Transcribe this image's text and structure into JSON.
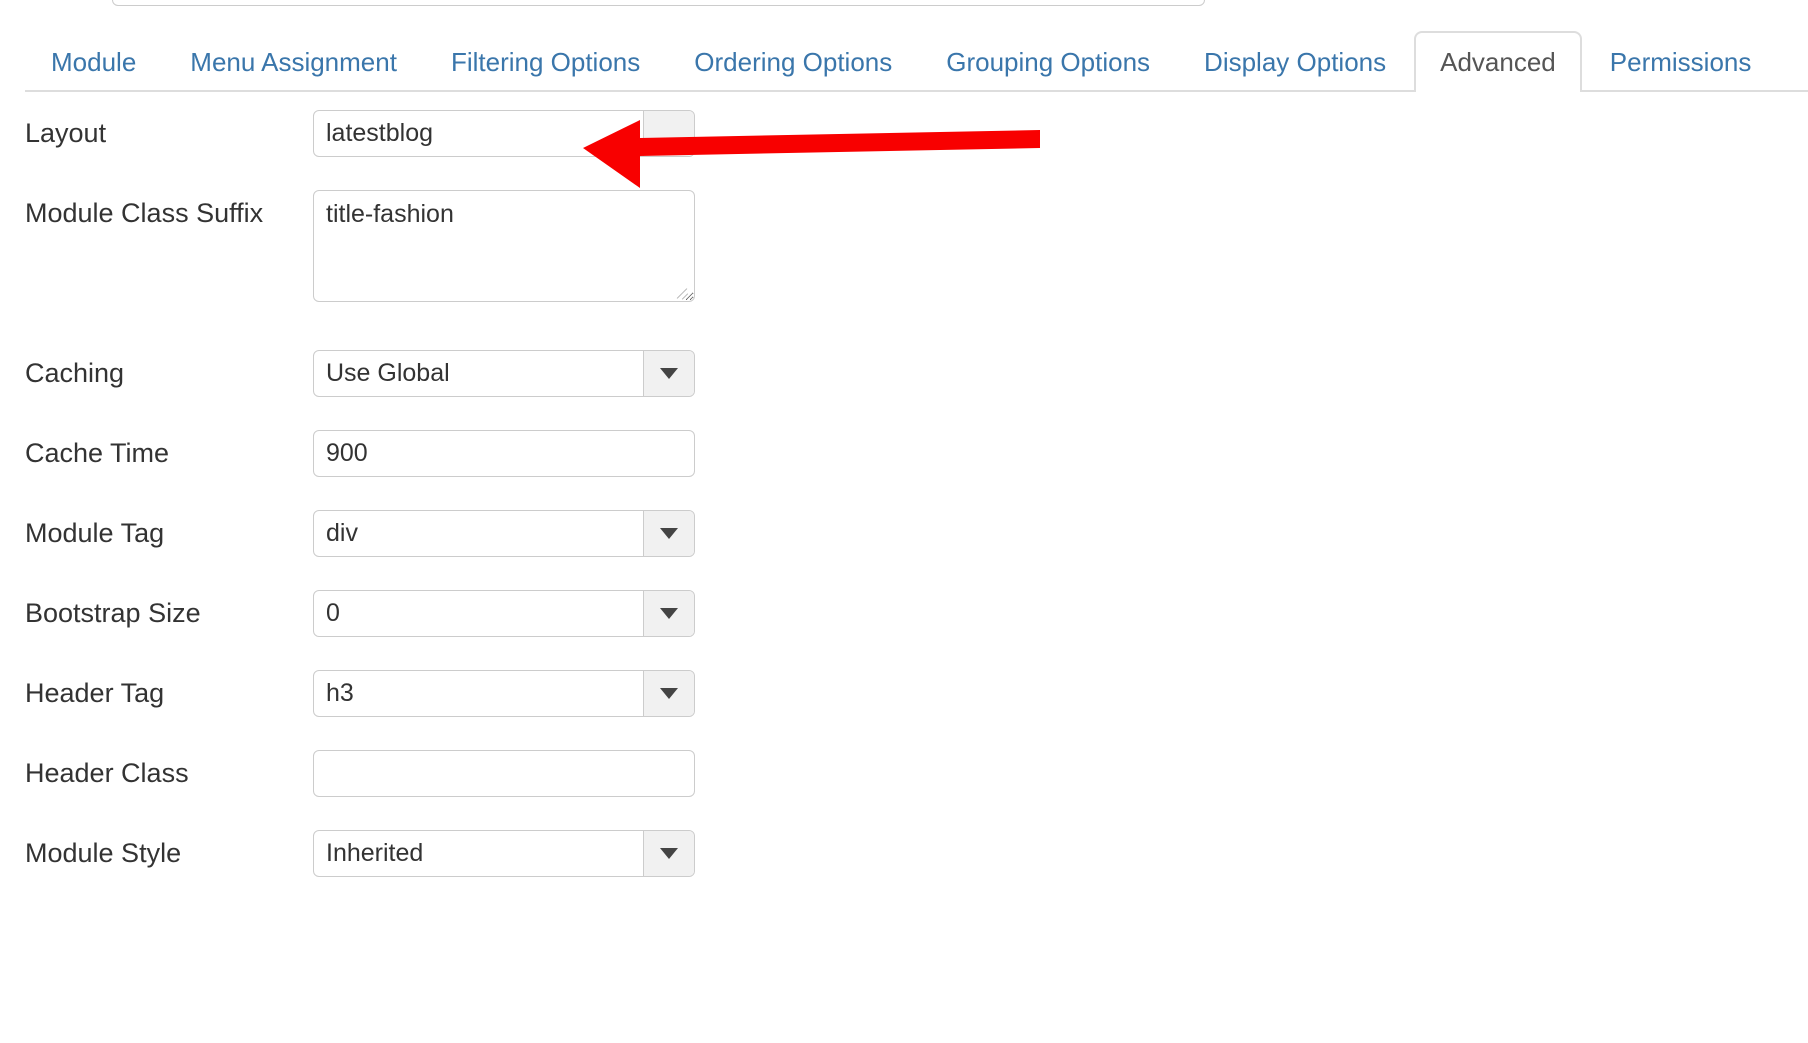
{
  "tabs": [
    {
      "label": "Module",
      "active": false
    },
    {
      "label": "Menu Assignment",
      "active": false
    },
    {
      "label": "Filtering Options",
      "active": false
    },
    {
      "label": "Ordering Options",
      "active": false
    },
    {
      "label": "Grouping Options",
      "active": false
    },
    {
      "label": "Display Options",
      "active": false
    },
    {
      "label": "Advanced",
      "active": true
    },
    {
      "label": "Permissions",
      "active": false
    }
  ],
  "fields": {
    "layout": {
      "label": "Layout",
      "value": "latestblog",
      "type": "select"
    },
    "module_class_suffix": {
      "label": "Module Class Suffix",
      "value": "title-fashion",
      "placeholder": "",
      "type": "textarea"
    },
    "caching": {
      "label": "Caching",
      "value": "Use Global",
      "type": "select"
    },
    "cache_time": {
      "label": "Cache Time",
      "value": "900",
      "placeholder": "",
      "type": "text"
    },
    "module_tag": {
      "label": "Module Tag",
      "value": "div",
      "type": "select"
    },
    "bootstrap_size": {
      "label": "Bootstrap Size",
      "value": "0",
      "type": "select"
    },
    "header_tag": {
      "label": "Header Tag",
      "value": "h3",
      "type": "select"
    },
    "header_class": {
      "label": "Header Class",
      "value": "",
      "placeholder": "",
      "type": "text"
    },
    "module_style": {
      "label": "Module Style",
      "value": "Inherited",
      "type": "select"
    }
  },
  "annotation": {
    "arrow_color": "#f80000",
    "points_to": "layout-select"
  },
  "colors": {
    "tab_link": "#3a76ab",
    "tab_active_text": "#555555",
    "border": "#cccccc",
    "text": "#333333",
    "select_button_bg": "#f1f1f1",
    "arrow_red": "#f80000"
  }
}
